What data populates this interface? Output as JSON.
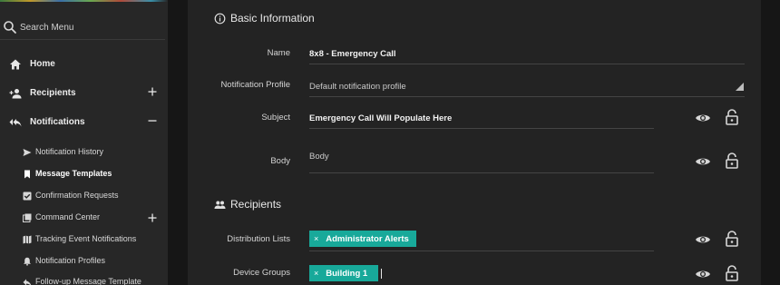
{
  "sidebar": {
    "search_placeholder": "Search Menu",
    "items": [
      {
        "label": "Home",
        "icon": "home-icon"
      },
      {
        "label": "Recipients",
        "icon": "add-person-icon",
        "toggle": "+"
      },
      {
        "label": "Notifications",
        "icon": "reply-all-icon",
        "toggle": "−"
      }
    ],
    "sub_items": [
      {
        "label": "Notification History",
        "icon": "send-icon"
      },
      {
        "label": "Message Templates",
        "icon": "bookmark-icon",
        "active": true
      },
      {
        "label": "Confirmation Requests",
        "icon": "checkbox-icon"
      },
      {
        "label": "Command Center",
        "icon": "library-icon",
        "toggle": "+"
      },
      {
        "label": "Tracking Event Notifications",
        "icon": "map-icon"
      },
      {
        "label": "Notification Profiles",
        "icon": "bell-icon"
      },
      {
        "label": "Follow-up Message Template",
        "icon": "reply-icon"
      }
    ]
  },
  "basic_info": {
    "title": "Basic Information",
    "name_label": "Name",
    "name_value": "8x8 - Emergency Call",
    "profile_label": "Notification Profile",
    "profile_value": "Default notification profile",
    "subject_label": "Subject",
    "subject_value": "Emergency Call Will Populate Here",
    "body_label": "Body",
    "body_placeholder": "Body"
  },
  "recipients": {
    "title": "Recipients",
    "distribution_label": "Distribution Lists",
    "distribution_chips": [
      "Administrator Alerts"
    ],
    "device_groups_label": "Device Groups",
    "device_group_chips": [
      "Building 1"
    ],
    "chip_remove": "×"
  },
  "colors": {
    "chip": "#18a99a",
    "sidebar_bg": "#272727",
    "main_bg": "#232323"
  }
}
